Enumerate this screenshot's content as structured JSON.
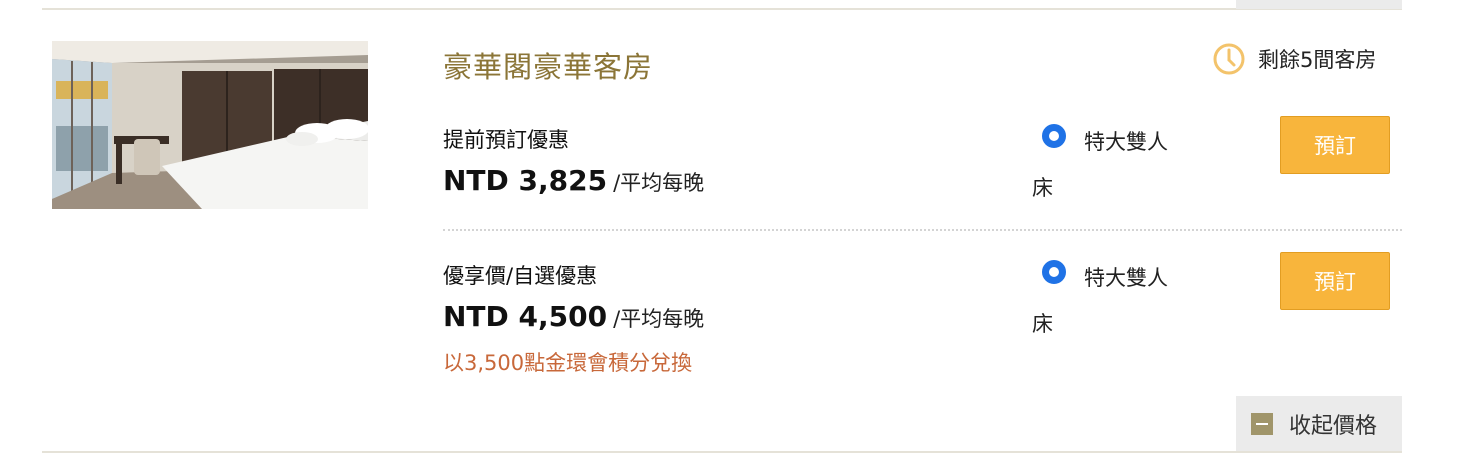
{
  "room": {
    "title": "豪華閣豪華客房",
    "availability": "剩餘5間客房",
    "photo_expand_glyph": "+"
  },
  "rates": [
    {
      "name": "提前預訂優惠",
      "price": "NTD 3,825",
      "per_night": "/平均每晚",
      "bed_line1": "特大雙人",
      "bed_line2": "床",
      "book_label": "預訂"
    },
    {
      "name": "優享價/自選優惠",
      "price": "NTD 4,500",
      "per_night": "/平均每晚",
      "points": "以3,500點金環會積分兌換",
      "bed_line1": "特大雙人",
      "bed_line2": "床",
      "book_label": "預訂"
    }
  ],
  "collapse_label": "收起價格",
  "colors": {
    "title_gold": "#8b7537",
    "button_orange": "#f8b53c",
    "points_orange": "#c8683a",
    "radio_blue": "#1f72e6"
  },
  "icons": [
    "clock-icon",
    "plus-icon",
    "minus-icon",
    "radio-selected-icon"
  ]
}
